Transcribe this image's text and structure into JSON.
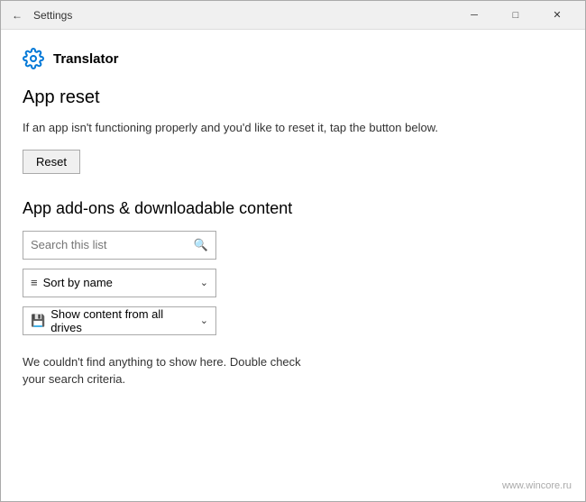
{
  "titlebar": {
    "title": "Settings",
    "back_label": "←",
    "minimize_label": "─",
    "maximize_label": "□",
    "close_label": "✕"
  },
  "app": {
    "name": "Translator"
  },
  "app_reset": {
    "heading": "App reset",
    "description": "If an app isn't functioning properly and you'd like to reset it, tap the button below.",
    "reset_button": "Reset"
  },
  "addons": {
    "heading": "App add-ons & downloadable content",
    "search_placeholder": "Search this list",
    "sort_label": "Sort by name",
    "filter_label": "Show content from all drives",
    "empty_message": "We couldn't find anything to show here. Double check your search criteria."
  },
  "watermark": "www.wincore.ru",
  "colors": {
    "accent": "#0078d7",
    "border": "#aaa",
    "background": "#fff",
    "titlebar_bg": "#f0f0f0"
  }
}
